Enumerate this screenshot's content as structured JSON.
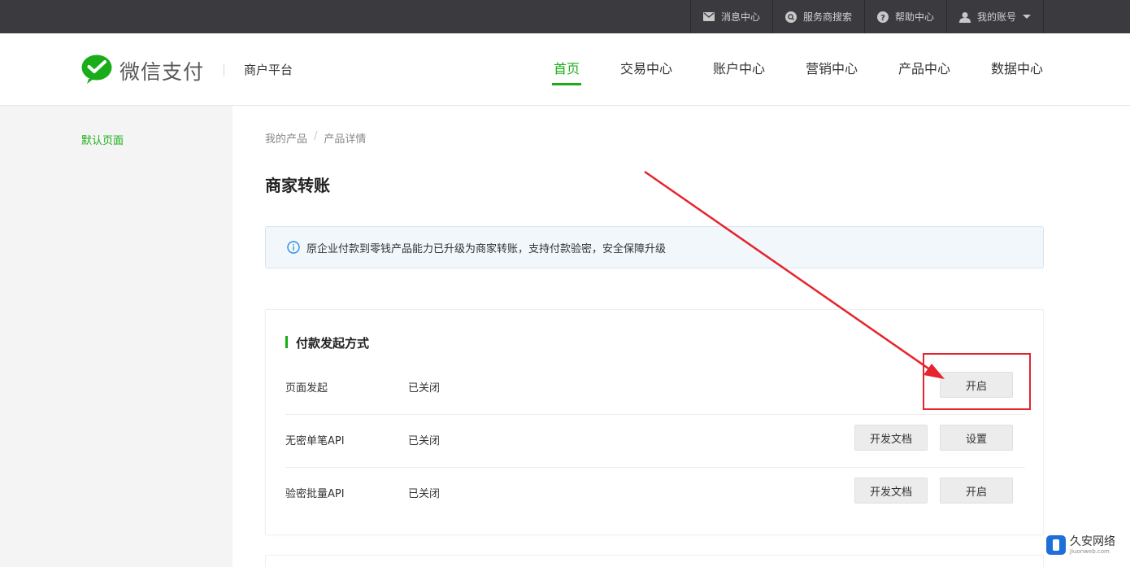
{
  "topbar": {
    "links": [
      {
        "label": "消息中心",
        "icon": "mail-icon"
      },
      {
        "label": "服务商搜索",
        "icon": "search-icon"
      },
      {
        "label": "帮助中心",
        "icon": "help-icon"
      },
      {
        "label": "我的账号",
        "icon": "user-icon"
      }
    ]
  },
  "header": {
    "logo_text": "微信支付",
    "platform": "商户平台",
    "nav": [
      "首页",
      "交易中心",
      "账户中心",
      "营销中心",
      "产品中心",
      "数据中心"
    ],
    "active_nav": "首页"
  },
  "sidebar": {
    "items": [
      {
        "label": "默认页面"
      }
    ]
  },
  "breadcrumb": [
    "我的产品",
    "产品详情"
  ],
  "page_title": "商家转账",
  "notice": "原企业付款到零钱产品能力已升级为商家转账，支持付款验密，安全保障升级",
  "section": {
    "title": "付款发起方式",
    "rows": [
      {
        "name": "页面发起",
        "status": "已关闭",
        "buttons": [
          "开启"
        ]
      },
      {
        "name": "无密单笔API",
        "status": "已关闭",
        "buttons": [
          "开发文档",
          "设置"
        ]
      },
      {
        "name": "验密批量API",
        "status": "已关闭",
        "buttons": [
          "开发文档",
          "开启"
        ]
      }
    ]
  },
  "watermark": {
    "line1": "久安网络",
    "line2": "Jiuonweb.com"
  },
  "colors": {
    "accent": "#1aad19",
    "annotation": "#e5242e",
    "topbar": "#3b3b3f"
  }
}
